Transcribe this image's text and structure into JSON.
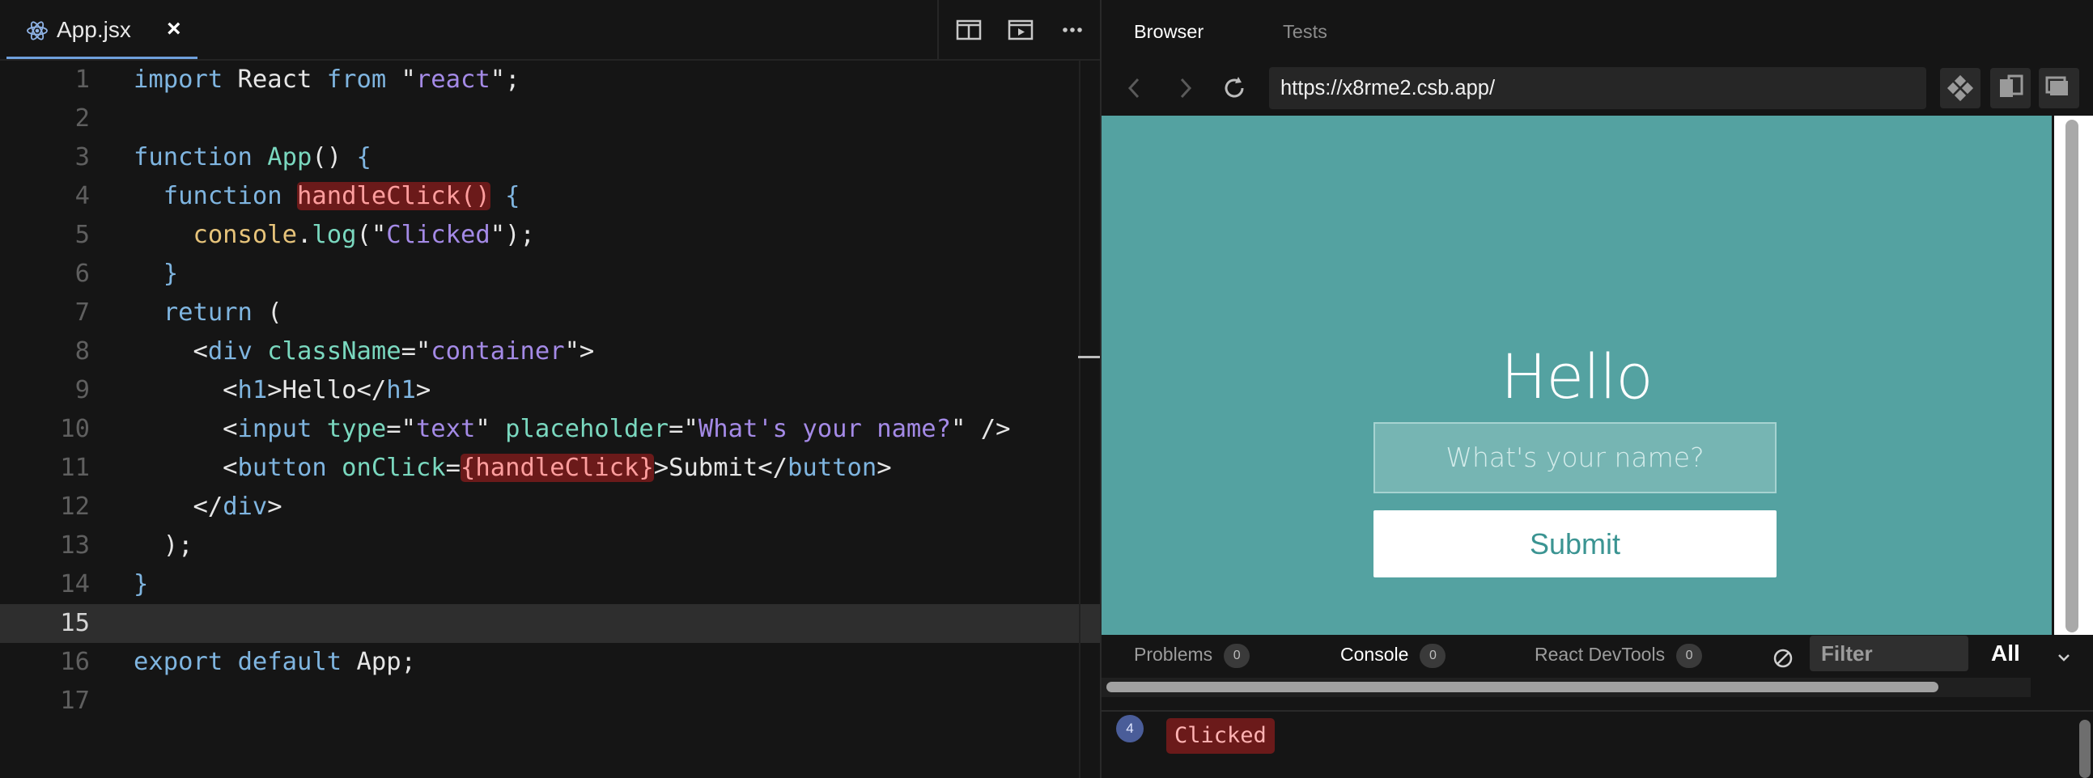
{
  "editor": {
    "tab": {
      "filename": "App.jsx",
      "close_glyph": "×"
    },
    "current_line": 15,
    "line_numbers": [
      "1",
      "2",
      "3",
      "4",
      "5",
      "6",
      "7",
      "8",
      "9",
      "10",
      "11",
      "12",
      "13",
      "14",
      "15",
      "16",
      "17"
    ]
  },
  "preview_panel": {
    "tabs": [
      "Browser",
      "Tests"
    ],
    "active_tab": "Browser",
    "url": "https://x8rme2.csb.app/",
    "page": {
      "heading": "Hello",
      "input_placeholder": "What's your name?",
      "button_label": "Submit",
      "background_color": "#54a2a1"
    }
  },
  "console_panel": {
    "tabs": [
      {
        "label": "Problems",
        "count": "0"
      },
      {
        "label": "Console",
        "count": "0"
      },
      {
        "label": "React DevTools",
        "count": "0"
      }
    ],
    "active_tab": "Console",
    "filter_placeholder": "Filter",
    "level": "All",
    "logs": [
      {
        "count": "4",
        "message": "Clicked"
      }
    ]
  },
  "colors": {
    "keyword": "#7fb5e0",
    "function_name": "#7ad8bf",
    "string": "#a48ae6",
    "error_highlight": "#6b1a1a"
  }
}
